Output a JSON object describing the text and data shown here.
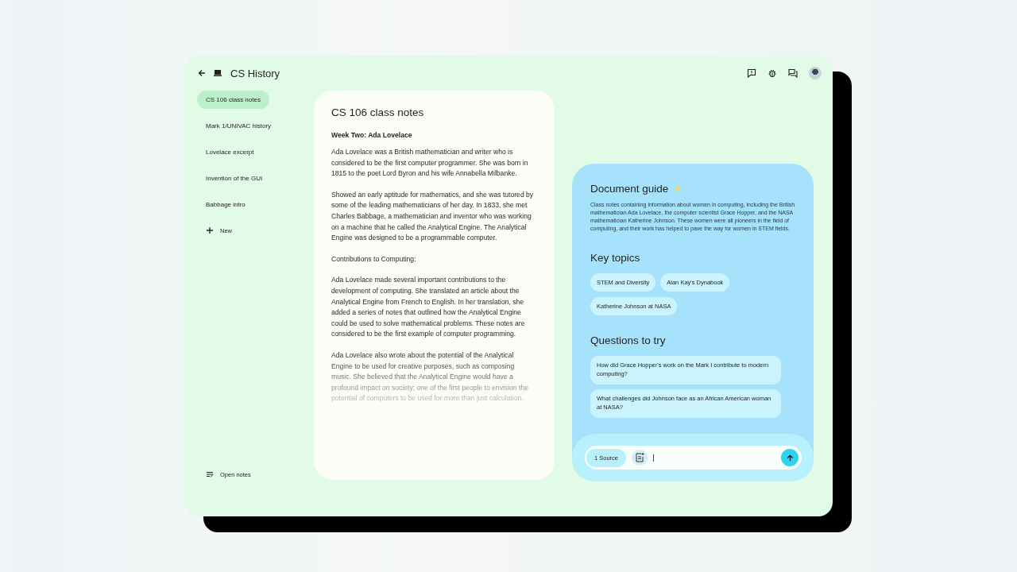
{
  "window": {
    "title": "CS History"
  },
  "sidebar": {
    "items": [
      {
        "label": "CS 106 class notes",
        "selected": true
      },
      {
        "label": "Mark 1/UNIVAC history",
        "selected": false
      },
      {
        "label": "Lovelace excerpt",
        "selected": false
      },
      {
        "label": "Invention of the GUI",
        "selected": false
      },
      {
        "label": "Babbage intro",
        "selected": false
      }
    ],
    "new_button": "New",
    "open_notes": "Open notes"
  },
  "document": {
    "title": "CS 106 class notes",
    "heading": "Week Two: Ada Lovelace",
    "paragraphs": [
      "Ada Lovelace was a British mathematician and writer who is considered to be the first computer programmer. She was born in 1815 to the poet Lord Byron and his wife Annabella Milbanke.",
      "Showed an early aptitude for mathematics, and she was tutored by some of the leading mathematicians of her day. In 1833, she met Charles Babbage, a mathematician and inventor who was working on a machine that he called the Analytical Engine. The Analytical Engine was designed to be a programmable computer.",
      "Contributions to Computing:",
      "Ada Lovelace made several important contributions to the development of computing. She translated an article about the Analytical Engine from French to English. In her translation, she added a series of notes that outlined how the Analytical Engine could be used to solve mathematical problems. These notes are considered to be the first example of computer programming.",
      "Ada Lovelace also wrote about the potential of the Analytical Engine to be used for creative purposes, such as composing music. She believed that the Analytical Engine would have a profound impact on society; one of the first people to envision the potential of computers to be used for more than just calculation."
    ]
  },
  "guide": {
    "title": "Document guide",
    "summary": "Class notes containing information about women in computing, including the British mathematician Ada Lovelace, the computer scientist Grace Hopper, and the NASA mathematician Katherine Johnson. These women were all pioneers in the field of computing, and their work has helped to pave the way for women in STEM fields.",
    "topics_title": "Key topics",
    "topics": [
      "STEM and Diversity",
      "Alan Kay's Dynabook",
      "Katherine Johnson at NASA"
    ],
    "questions_title": "Questions to try",
    "questions": [
      "How did Grace Hopper's work on the Mark I contribute to modern computing?",
      "What challenges did Johnson face as an African American woman at NASA?"
    ],
    "composer": {
      "source_chip": "1 Source"
    }
  }
}
